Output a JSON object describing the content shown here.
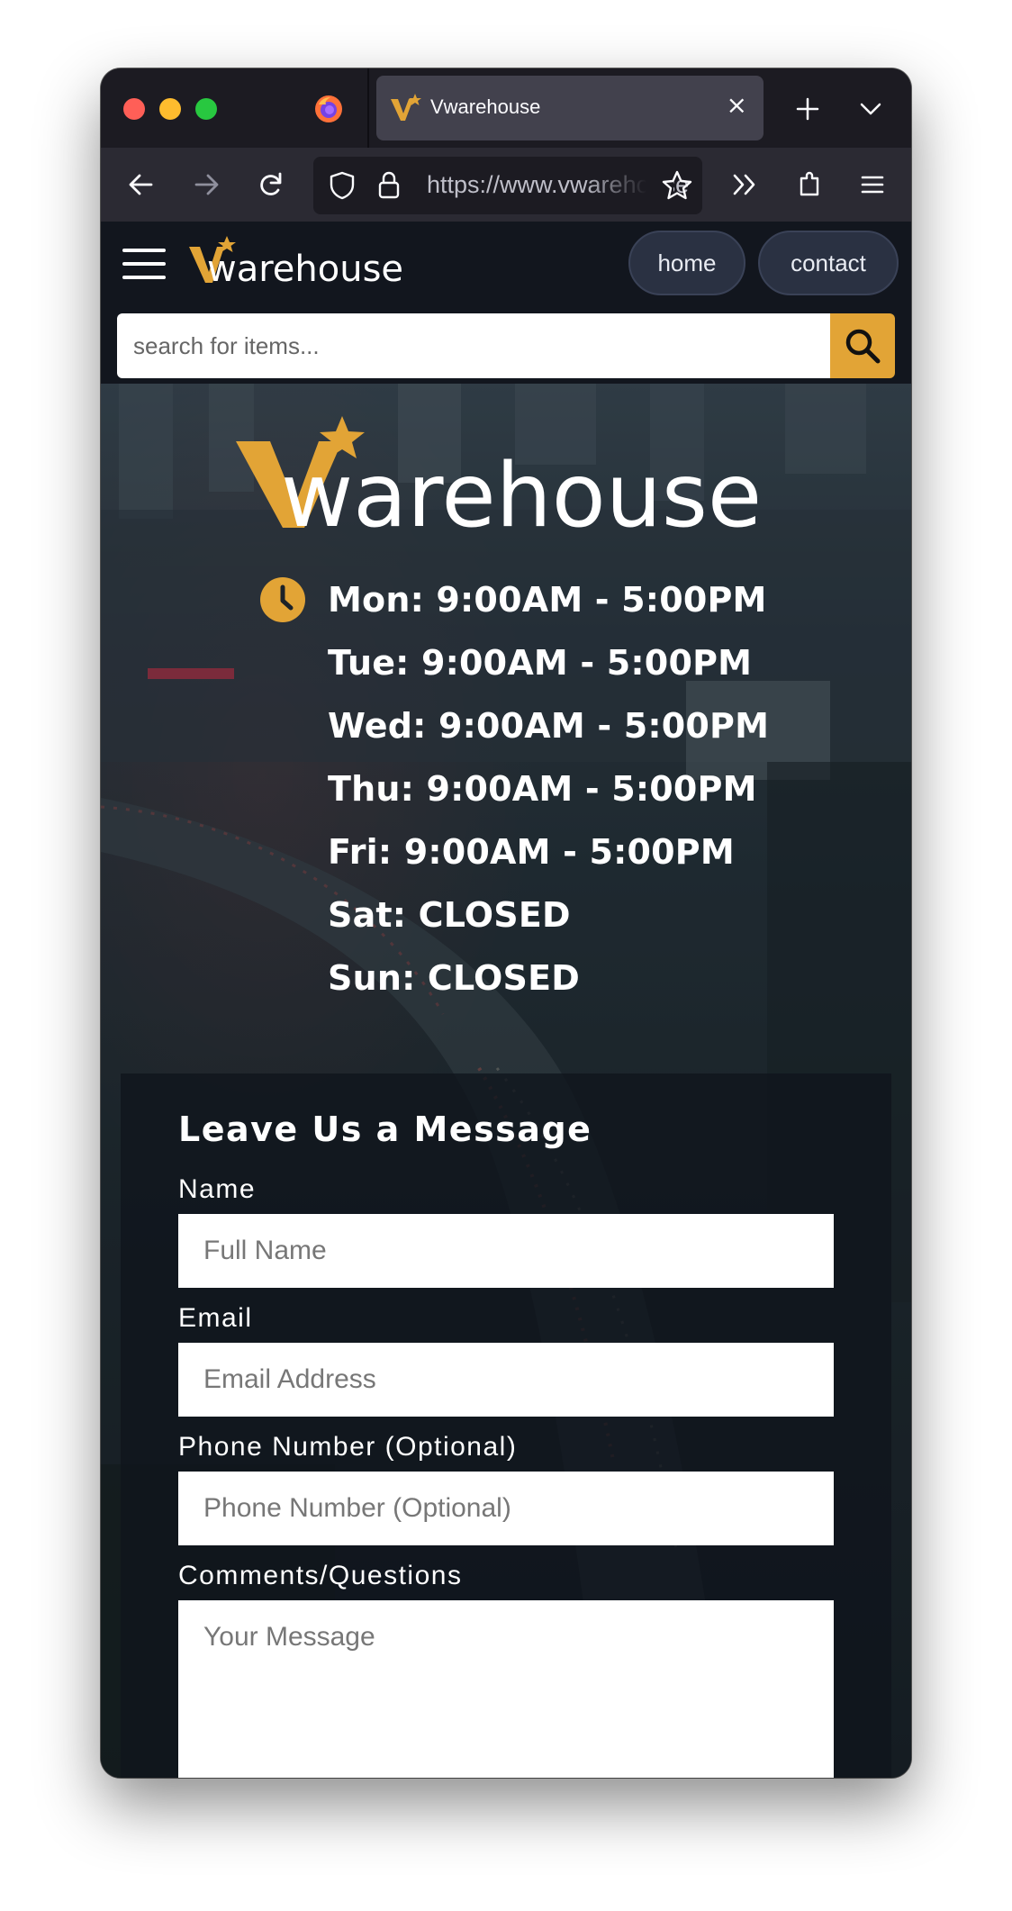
{
  "browser": {
    "tab_title": "Vwarehouse",
    "tab_close": "×",
    "url": "https://www.vwarehouse",
    "url_host_bold": "vwareh"
  },
  "site": {
    "nav": {
      "home_label": "home",
      "contact_label": "contact"
    },
    "search": {
      "placeholder": "search for items..."
    },
    "logo_text": "warehouse",
    "hours": [
      "Mon: 9:00AM - 5:00PM",
      "Tue: 9:00AM - 5:00PM",
      "Wed: 9:00AM - 5:00PM",
      "Thu: 9:00AM - 5:00PM",
      "Fri: 9:00AM - 5:00PM",
      "Sat: CLOSED",
      "Sun: CLOSED"
    ],
    "form": {
      "title": "Leave Us a Message",
      "name_label": "Name",
      "name_placeholder": "Full Name",
      "email_label": "Email",
      "email_placeholder": "Email Address",
      "phone_label": "Phone Number (Optional)",
      "phone_placeholder": "Phone Number (Optional)",
      "comments_label": "Comments/Questions",
      "comments_placeholder": "Your Message"
    }
  },
  "colors": {
    "accent": "#e2a436",
    "header_bg": "#12161e",
    "pill_bg": "#2a3142"
  }
}
